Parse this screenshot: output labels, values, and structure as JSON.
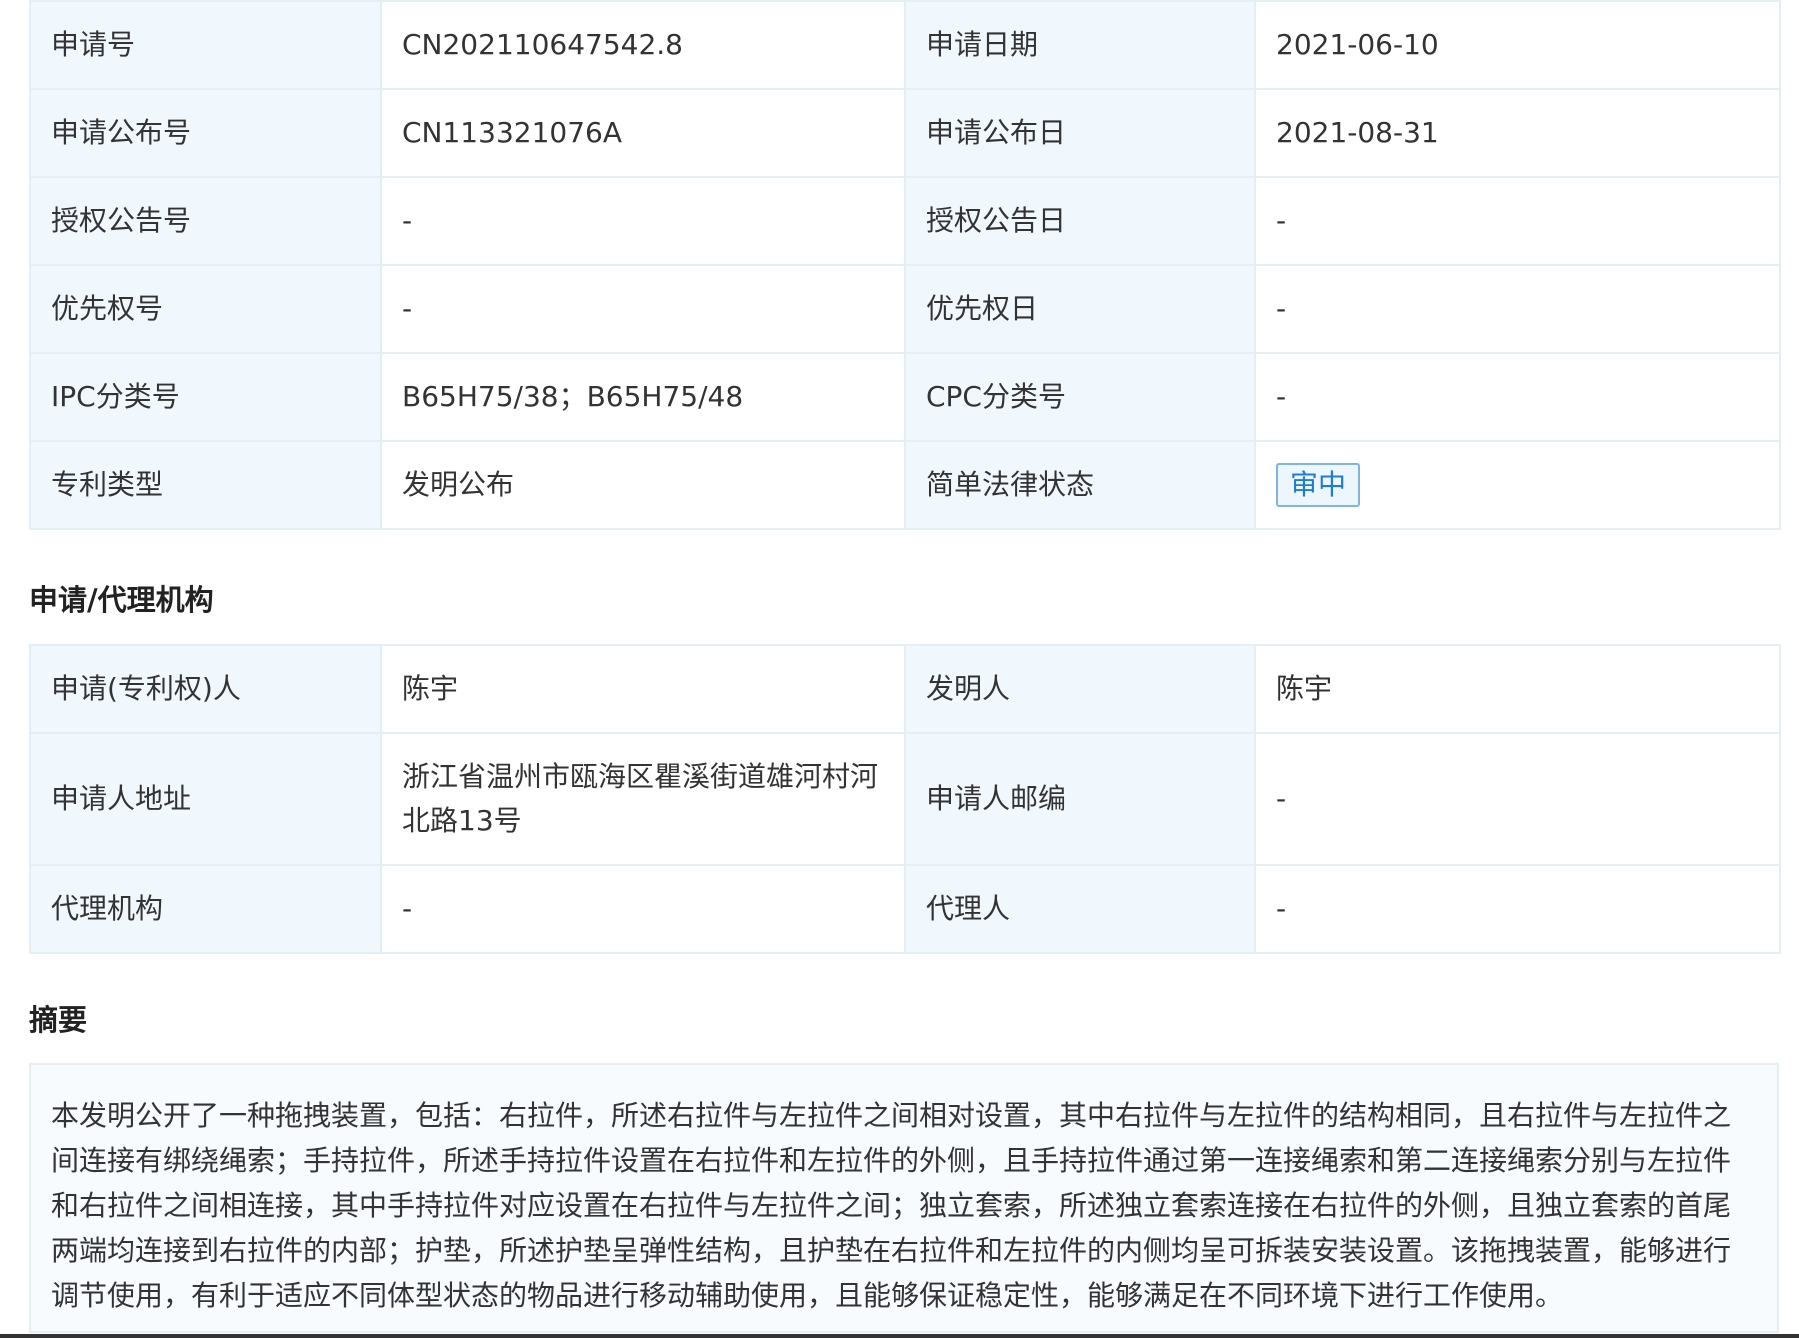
{
  "basic_info": {
    "rows": [
      {
        "label1": "申请号",
        "value1": "CN202110647542.8",
        "label2": "申请日期",
        "value2": "2021-06-10"
      },
      {
        "label1": "申请公布号",
        "value1": "CN113321076A",
        "label2": "申请公布日",
        "value2": "2021-08-31"
      },
      {
        "label1": "授权公告号",
        "value1": "-",
        "label2": "授权公告日",
        "value2": "-"
      },
      {
        "label1": "优先权号",
        "value1": "-",
        "label2": "优先权日",
        "value2": "-"
      },
      {
        "label1": "IPC分类号",
        "value1": "B65H75/38；B65H75/48",
        "label2": "CPC分类号",
        "value2": "-"
      },
      {
        "label1": "专利类型",
        "value1": "发明公布",
        "label2": "简单法律状态",
        "value2": "审中"
      }
    ]
  },
  "agency": {
    "title": "申请/代理机构",
    "rows": [
      {
        "label1": "申请(专利权)人",
        "value1": "陈宇",
        "label2": "发明人",
        "value2": "陈宇"
      },
      {
        "label1": "申请人地址",
        "value1": "浙江省温州市瓯海区瞿溪街道雄河村河北路13号",
        "label2": "申请人邮编",
        "value2": "-"
      },
      {
        "label1": "代理机构",
        "value1": "-",
        "label2": "代理人",
        "value2": "-"
      }
    ]
  },
  "abstract": {
    "title": "摘要",
    "text": "本发明公开了一种拖拽装置，包括：右拉件，所述右拉件与左拉件之间相对设置，其中右拉件与左拉件的结构相同，且右拉件与左拉件之间连接有绑绕绳索；手持拉件，所述手持拉件设置在右拉件和左拉件的外侧，且手持拉件通过第一连接绳索和第二连接绳索分别与左拉件和右拉件之间相连接，其中手持拉件对应设置在右拉件与左拉件之间；独立套索，所述独立套索连接在右拉件的外侧，且独立套索的首尾两端均连接到右拉件的内部；护垫，所述护垫呈弹性结构，且护垫在右拉件和左拉件的内侧均呈可拆装安装设置。该拖拽装置，能够进行调节使用，有利于适应不同体型状态的物品进行移动辅助使用，且能够保证稳定性，能够满足在不同环境下进行工作使用。"
  },
  "colors": {
    "label_bg": "#f0f8fd",
    "border": "#e4eef5",
    "badge_text": "#1e7bd6",
    "badge_border": "#7fb5e6"
  }
}
